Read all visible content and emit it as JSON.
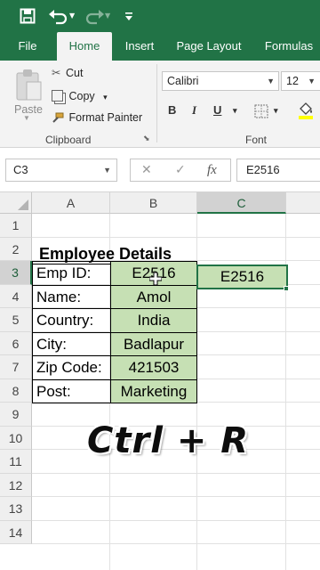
{
  "qat": {
    "save_icon": "save-icon",
    "undo_icon": "undo-icon",
    "redo_icon": "redo-icon",
    "customize_icon": "customize-icon"
  },
  "tabs": [
    {
      "label": "File",
      "active": false
    },
    {
      "label": "Home",
      "active": true
    },
    {
      "label": "Insert",
      "active": false
    },
    {
      "label": "Page Layout",
      "active": false
    },
    {
      "label": "Formulas",
      "active": false
    }
  ],
  "ribbon": {
    "clipboard": {
      "paste_label": "Paste",
      "cut_label": "Cut",
      "copy_label": "Copy",
      "format_painter_label": "Format Painter",
      "group_label": "Clipboard"
    },
    "font": {
      "font_name": "Calibri",
      "font_size": "12",
      "bold": "B",
      "italic": "I",
      "underline": "U",
      "group_label": "Font"
    }
  },
  "formula_bar": {
    "name_box": "C3",
    "cancel_icon": "✕",
    "enter_icon": "✓",
    "fx_label": "fx",
    "formula": "E2516"
  },
  "grid": {
    "columns": [
      "A",
      "B",
      "C"
    ],
    "selected_column": "C",
    "rows": [
      "1",
      "2",
      "3",
      "4",
      "5",
      "6",
      "7",
      "8",
      "9",
      "10",
      "11",
      "12",
      "13",
      "14"
    ],
    "selected_row": "3",
    "title": "Employee Details",
    "labels": [
      "Emp ID:",
      "Name:",
      "Country:",
      "City:",
      "Zip Code:",
      "Post:"
    ],
    "values": [
      "E2516",
      "Amol",
      "India",
      "Badlapur",
      "421503",
      "Marketing"
    ],
    "c3_value": "E2516"
  },
  "overlay": {
    "shortcut_text": "Ctrl + R"
  },
  "colors": {
    "excel_green": "#217346",
    "cell_fill": "#c6e0b4"
  }
}
